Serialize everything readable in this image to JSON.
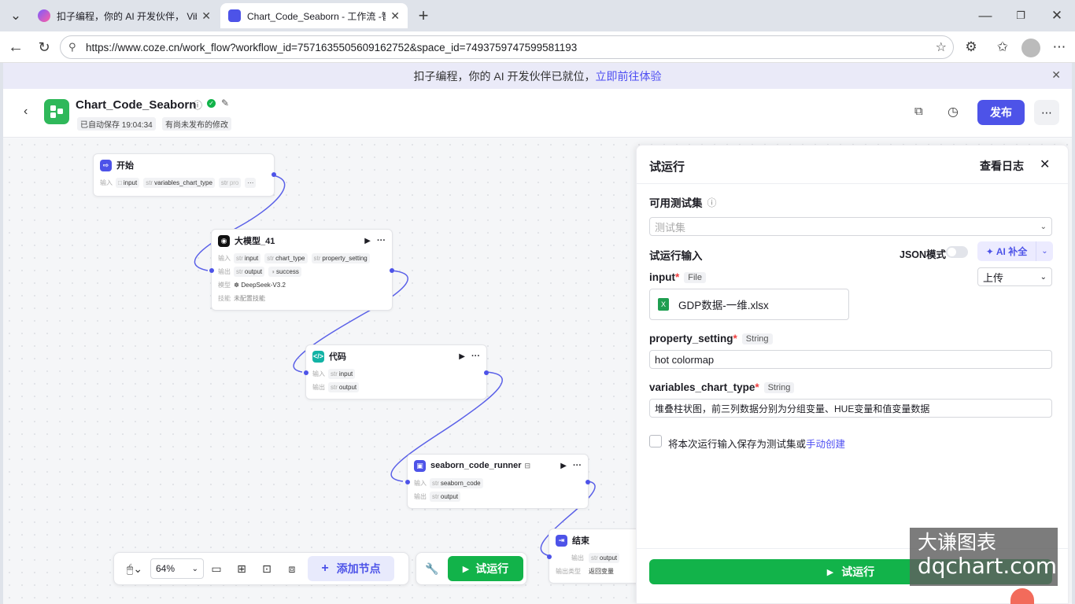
{
  "browser": {
    "tabs": [
      {
        "title": "扣子编程，你的 AI 开发伙伴， Vib"
      },
      {
        "title": "Chart_Code_Seaborn - 工作流 -智能"
      }
    ],
    "new_tab": "+",
    "url": "https://www.coze.cn/work_flow?workflow_id=7571635505609162752&space_id=7493759747599581193"
  },
  "banner": {
    "text": "扣子编程，你的 AI 开发伙伴已就位，",
    "link": "立即前往体验"
  },
  "header": {
    "title": "Chart_Code_Seaborn",
    "autosave": "已自动保存 19:04:34",
    "unpublished": "有尚未发布的修改",
    "publish": "发布"
  },
  "nodes": {
    "start": {
      "title": "开始",
      "input_label": "输入",
      "chips": [
        "input",
        "variables_chart_type",
        "pro"
      ],
      "more": "···"
    },
    "llm": {
      "title": "大模型_41",
      "input_label": "输入",
      "output_label": "输出",
      "model_label": "模型",
      "skill_label": "技能",
      "inputs": [
        "input",
        "chart_type",
        "property_setting"
      ],
      "outputs": [
        "output",
        "success"
      ],
      "model": "DeepSeek-V3.2",
      "skill": "未配置技能"
    },
    "code": {
      "title": "代码",
      "input_label": "输入",
      "output_label": "输出",
      "input": "input",
      "output": "output"
    },
    "runner": {
      "title": "seaborn_code_runner",
      "input_label": "输入",
      "output_label": "输出",
      "input": "seaborn_code",
      "output": "output"
    },
    "end": {
      "title": "结束",
      "output_label": "输出",
      "output_type_label": "输出类型",
      "output": "output",
      "output_type": "返回变量"
    },
    "str_tag": "str"
  },
  "panel": {
    "title": "试运行",
    "view_logs": "查看日志",
    "testset_label": "可用测试集",
    "testset_placeholder": "测试集",
    "run_input_label": "试运行输入",
    "json_mode": "JSON模式",
    "ai_fill": "AI 补全",
    "input_name": "input",
    "input_type": "File",
    "upload": "上传",
    "file_name": "GDP数据-一维.xlsx",
    "property_name": "property_setting",
    "property_type": "String",
    "property_value": "hot colormap",
    "chart_type_name": "variables_chart_type",
    "chart_type_type": "String",
    "chart_type_value": "堆叠柱状图，前三列数据分别为分组变量、HUE变量和值变量数据",
    "save_text": "将本次运行输入保存为测试集或",
    "save_link": "手动创建",
    "run_button": "试运行"
  },
  "toolbar": {
    "zoom": "64%",
    "add_node": "添加节点",
    "run": "试运行"
  },
  "watermark": {
    "line1": "大谦图表",
    "line2": "dqchart.com"
  },
  "colors": {
    "accent": "#4d53e8",
    "green": "#12b34a",
    "link": "#4e4ef2"
  }
}
